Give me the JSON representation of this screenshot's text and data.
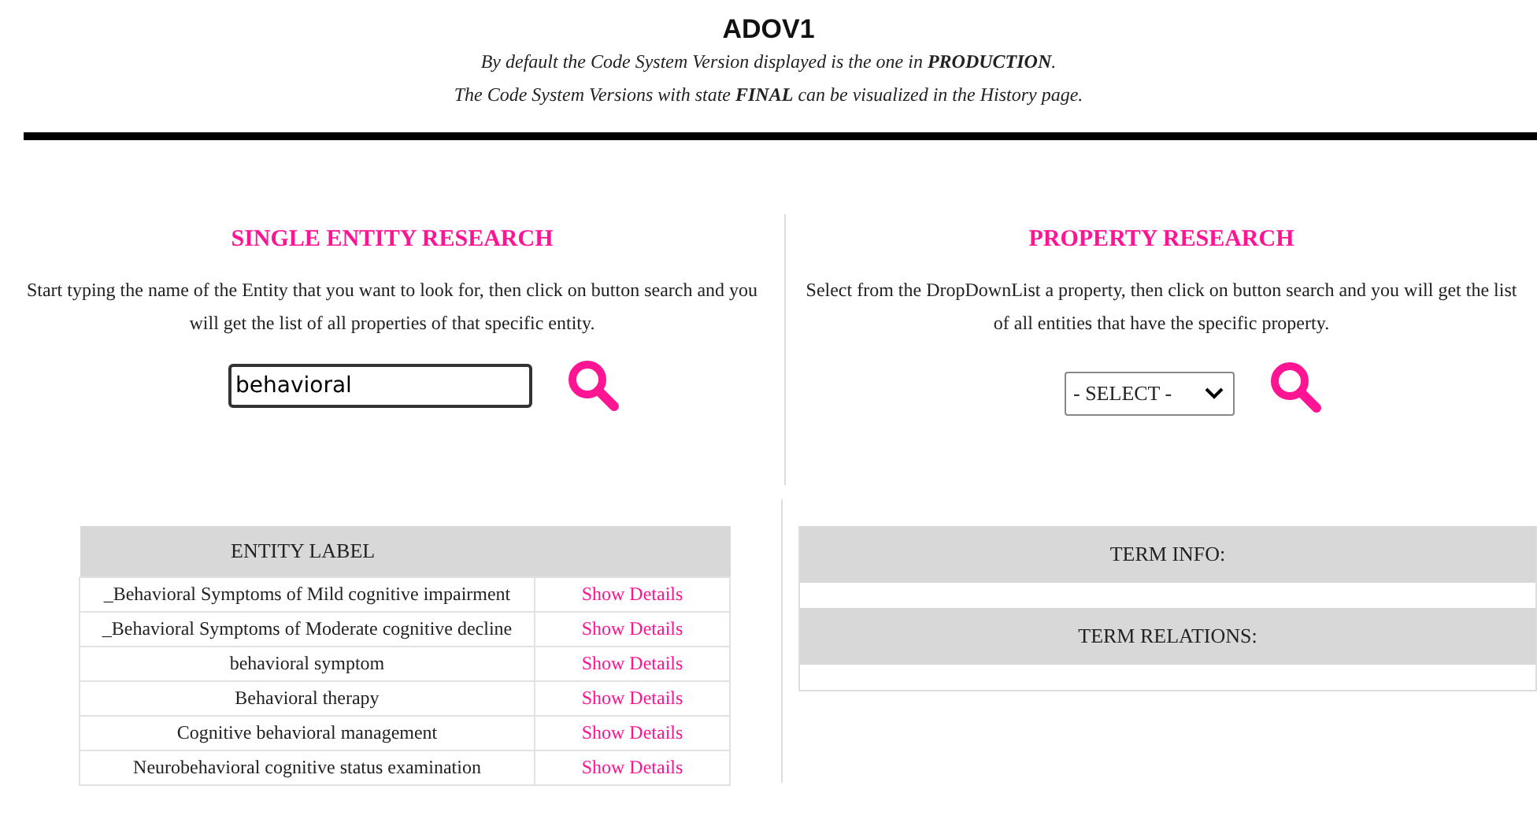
{
  "header": {
    "title": "ADOV1",
    "notes": [
      "By default the Code System Version displayed is the one in **PRODUCTION**.",
      "The Code System Versions with state **FINAL** can be visualized in the History page."
    ]
  },
  "entity_research": {
    "heading": "SINGLE ENTITY RESEARCH",
    "description": "Start typing the name of the Entity that you want to look for, then click on button search and you will get the list of all properties of that specific entity.",
    "search_value": "behavioral"
  },
  "property_research": {
    "heading": "PROPERTY RESEARCH",
    "description": "Select from the DropDownList a property, then click on button search and you will get the list of all entities that have the specific property.",
    "dropdown_value": "- SELECT -"
  },
  "results_table": {
    "columns": [
      "ENTITY LABEL"
    ],
    "rows": [
      {
        "label": "_Behavioral Symptoms of Mild cognitive impairment",
        "link": "Show Details"
      },
      {
        "label": "_Behavioral Symptoms of Moderate cognitive decline",
        "link": "Show Details"
      },
      {
        "label": "behavioral symptom",
        "link": "Show Details"
      },
      {
        "label": "Behavioral therapy",
        "link": "Show Details"
      },
      {
        "label": "Cognitive behavioral management",
        "link": "Show Details"
      },
      {
        "label": "Neurobehavioral cognitive status examination",
        "link": "Show Details"
      }
    ]
  },
  "term_panel": {
    "sections": [
      "TERM INFO:",
      "TERM RELATIONS:"
    ]
  }
}
